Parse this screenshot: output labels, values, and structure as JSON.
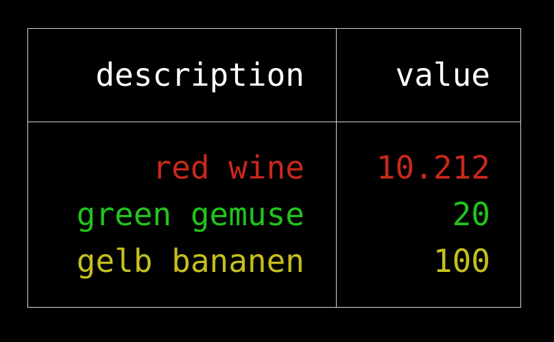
{
  "table": {
    "headers": {
      "description": "description",
      "value": "value"
    },
    "rows": [
      {
        "description": "red wine",
        "value": "10.212",
        "color": "#c8281c"
      },
      {
        "description": "green gemuse",
        "value": "20",
        "color": "#22c41c"
      },
      {
        "description": "gelb bananen",
        "value": "100",
        "color": "#c4c01c"
      }
    ]
  }
}
